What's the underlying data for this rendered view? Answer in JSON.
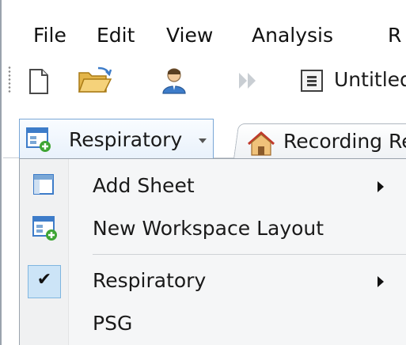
{
  "menubar": {
    "items": [
      {
        "label": "File"
      },
      {
        "label": "Edit"
      },
      {
        "label": "View"
      },
      {
        "label": "Analysis"
      },
      {
        "label": "R"
      }
    ]
  },
  "toolbar": {
    "document_title": "Untitled",
    "icons": [
      "new-document-icon",
      "open-folder-icon",
      "user-icon",
      "play-forward-icon",
      "document-list-icon"
    ]
  },
  "tabs": {
    "workspace_label": "Respiratory",
    "recording_label": "Recording Re"
  },
  "dropdown": {
    "items": [
      {
        "label": "Add Sheet",
        "has_submenu": true,
        "icon": "sheet-icon"
      },
      {
        "label": "New Workspace Layout",
        "has_submenu": false,
        "icon": "new-workspace-icon"
      },
      {
        "label": "Respiratory",
        "has_submenu": true,
        "checked": true
      },
      {
        "label": "PSG",
        "has_submenu": false
      }
    ],
    "check_glyph": "✔"
  },
  "colors": {
    "accent_blue": "#3d7cc9",
    "accent_green": "#3fa535",
    "selection": "#cce4f7"
  }
}
